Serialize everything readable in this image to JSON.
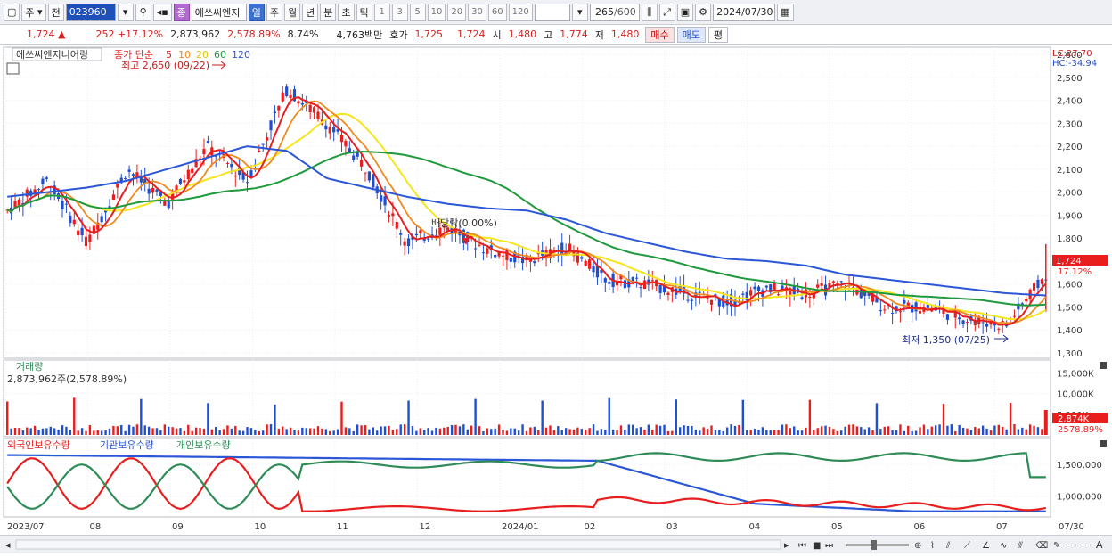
{
  "toolbar": {
    "period_label": "주",
    "prev_label": "전",
    "stock_code": "023960",
    "stock_badge": "종",
    "stock_name": "에쓰씨엔지",
    "tabs": [
      "일",
      "주",
      "월",
      "년",
      "분",
      "초",
      "틱"
    ],
    "numbers": [
      "1",
      "3",
      "5",
      "10",
      "20",
      "30",
      "60",
      "120"
    ],
    "count_value": "265",
    "count_total": "/600",
    "date": "2024/07/30"
  },
  "quote": {
    "price": "1,724",
    "change": "252",
    "change_pct": "+17.12%",
    "volume": "2,873,962",
    "volume_pct": "2,578.89%",
    "turnover": "8.74%",
    "amount": "4,763백만",
    "ask_label": "호가",
    "ask": "1,725",
    "bid": "1,724",
    "open_label": "시",
    "open": "1,480",
    "high_label": "고",
    "high": "1,774",
    "low_label": "저",
    "low": "1,480",
    "buy_label": "매수",
    "sell_label": "매도",
    "avg_label": "평"
  },
  "price_panel": {
    "stock_title": "에쓰씨엔지니어링",
    "ma_title": "종가 단순",
    "ma_periods": [
      "5",
      "10",
      "20",
      "60",
      "120"
    ],
    "high_annot": "최고 2,650 (09/22)",
    "low_annot": "최저 1,350 (07/25)",
    "dividend_annot": "배당락(0.00%)",
    "lc": "LC:27.70",
    "hc": "HC:-34.94",
    "y_ticks": [
      "2,600",
      "2,500",
      "2,400",
      "2,300",
      "2,200",
      "2,100",
      "2,000",
      "1,900",
      "1,800",
      "1,700",
      "1,600",
      "1,500",
      "1,400",
      "1,300"
    ],
    "current_price_tag": "1,724",
    "current_pct_tag": "17.12%"
  },
  "volume_panel": {
    "title": "거래량",
    "value": "2,873,962주(2,578.89%)",
    "y_ticks": [
      "15,000K",
      "10,000K",
      "5,000K"
    ],
    "tag": "2,874K",
    "tag_pct": "2578.89%"
  },
  "holding_panel": {
    "legend": [
      "외국인보유수량",
      "기관보유수량",
      "개인보유수량"
    ],
    "y_ticks": [
      "1,500,000",
      "1,000,000"
    ]
  },
  "x_axis": [
    "2023/07",
    "08",
    "09",
    "10",
    "11",
    "12",
    "2024/01",
    "02",
    "03",
    "04",
    "05",
    "06",
    "07",
    "07/30"
  ],
  "colors": {
    "ma5": "#e81e1e",
    "ma10": "#f08a1e",
    "ma20": "#f5e61e",
    "ma60": "#1e9a3c",
    "ma120": "#2a56d8",
    "up": "#e81e1e",
    "down": "#1f4fd1",
    "foreign": "#e81e1e",
    "institution": "#2a56d8",
    "individual": "#2e8b57"
  },
  "chart_data": {
    "type": "line",
    "series": [
      {
        "name": "5",
        "values": [
          1920,
          2050,
          1780,
          2100,
          1950,
          2200,
          2050,
          2450,
          2300,
          2100,
          1780,
          1850,
          1750,
          1700,
          1760,
          1620,
          1600,
          1560,
          1520,
          1580,
          1560,
          1600,
          1500,
          1500,
          1450,
          1420,
          1640
        ]
      },
      {
        "name": "120",
        "values": [
          1980,
          2000,
          2020,
          2050,
          2100,
          2150,
          2200,
          2180,
          2060,
          2020,
          1980,
          1950,
          1930,
          1920,
          1880,
          1820,
          1780,
          1740,
          1710,
          1700,
          1680,
          1640,
          1620,
          1600,
          1580,
          1560,
          1550
        ]
      }
    ],
    "ylim": [
      1300,
      2600
    ]
  }
}
